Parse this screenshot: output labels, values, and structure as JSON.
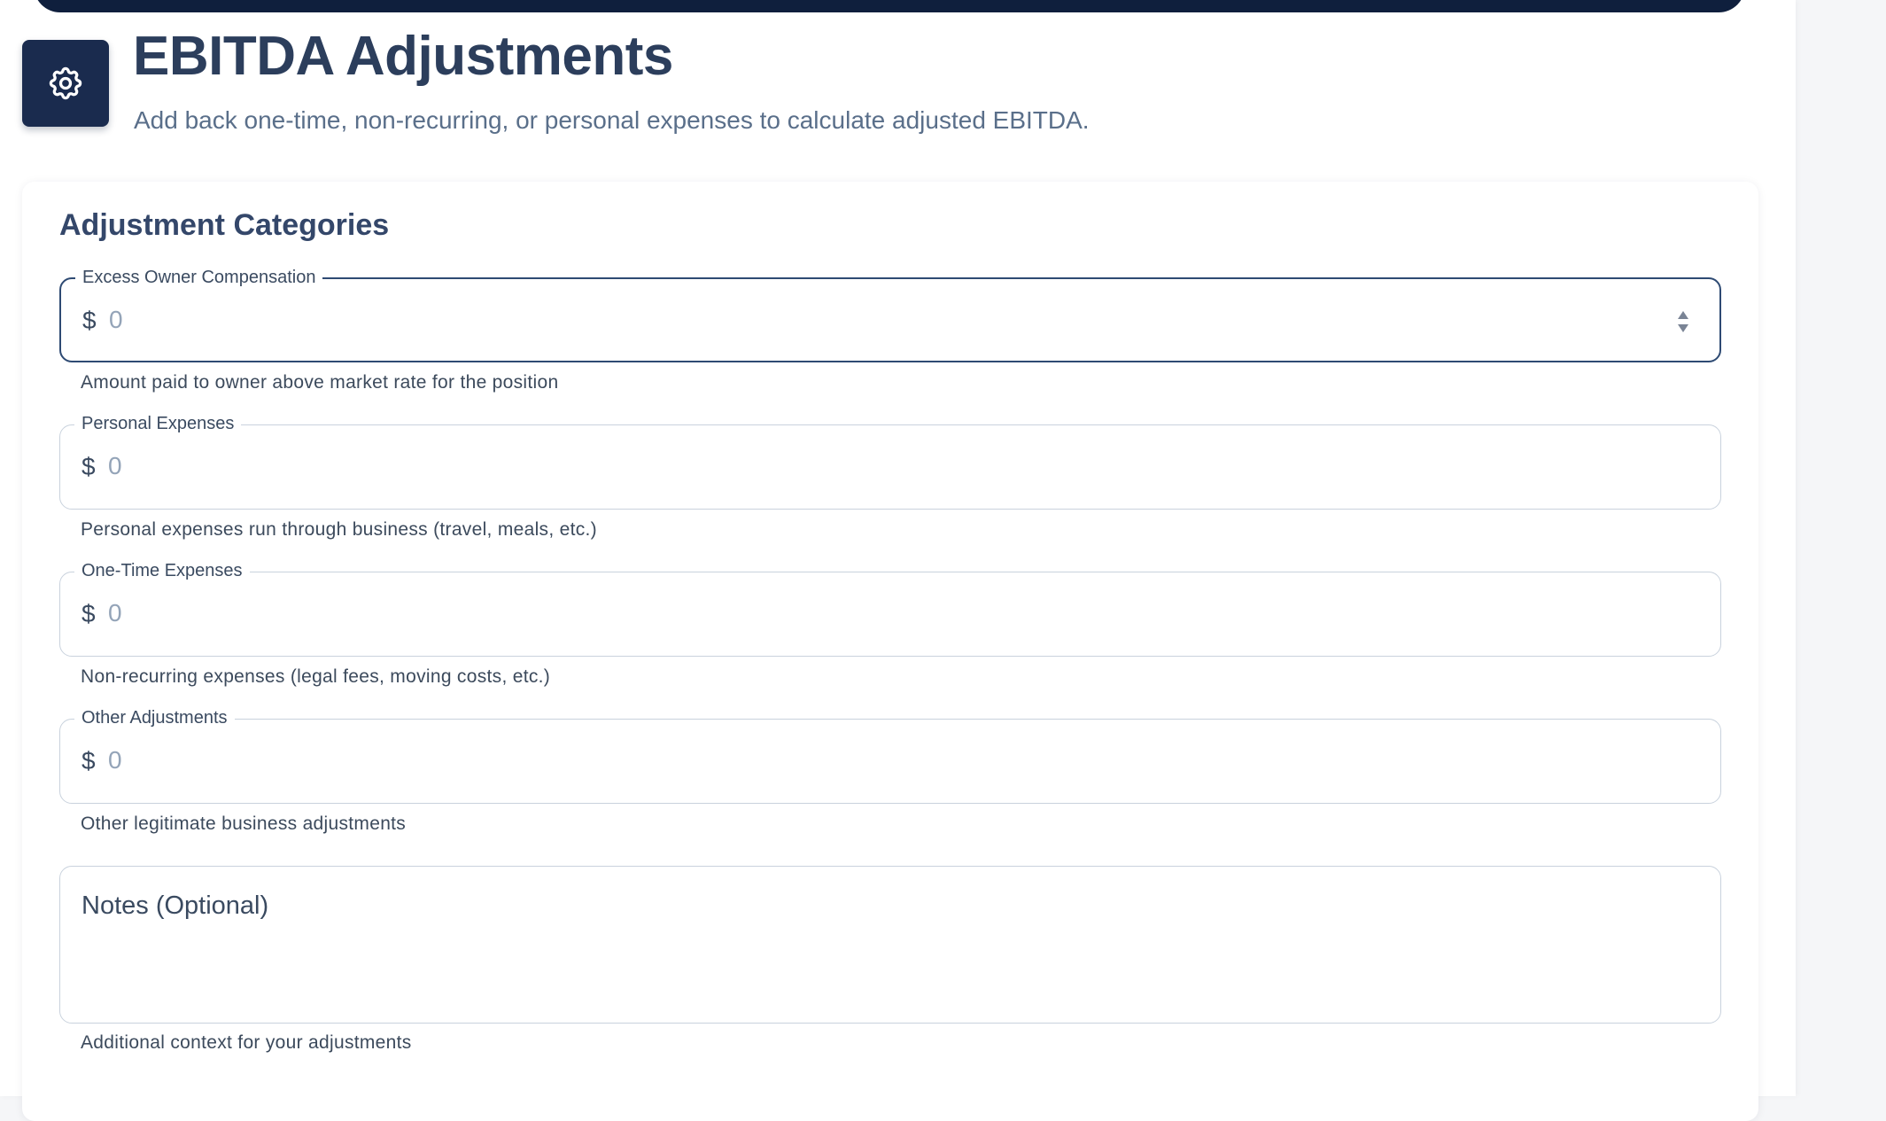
{
  "header": {
    "title": "EBITDA Adjustments",
    "subtitle": "Add back one-time, non-recurring, or personal expenses to calculate adjusted EBITDA.",
    "icon": "gear-icon"
  },
  "card": {
    "title": "Adjustment Categories"
  },
  "fields": [
    {
      "label": "Excess Owner Compensation",
      "prefix": "$",
      "placeholder": "0",
      "helper": "Amount paid to owner above market rate for the position"
    },
    {
      "label": "Personal Expenses",
      "prefix": "$",
      "placeholder": "0",
      "helper": "Personal expenses run through business (travel, meals, etc.)"
    },
    {
      "label": "One-Time Expenses",
      "prefix": "$",
      "placeholder": "0",
      "helper": "Non-recurring expenses (legal fees, moving costs, etc.)"
    },
    {
      "label": "Other Adjustments",
      "prefix": "$",
      "placeholder": "0",
      "helper": "Other legitimate business adjustments"
    }
  ],
  "notes": {
    "placeholder": "Notes (Optional)",
    "helper": "Additional context for your adjustments"
  },
  "colors": {
    "navy": "#0f1f3d",
    "icon_bg": "#1a2b4e",
    "title": "#2c3e5c",
    "focused_border": "#2e4a73"
  }
}
